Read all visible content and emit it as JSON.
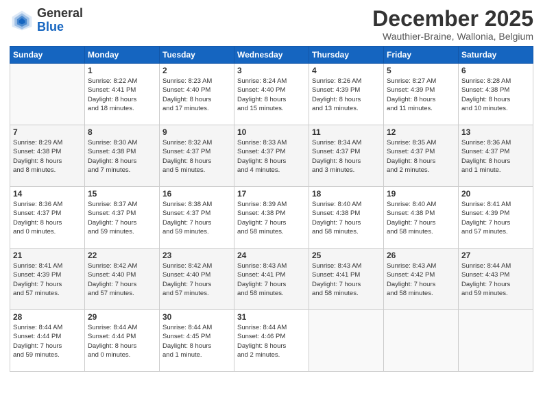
{
  "header": {
    "logo_general": "General",
    "logo_blue": "Blue",
    "month_title": "December 2025",
    "location": "Wauthier-Braine, Wallonia, Belgium"
  },
  "days_of_week": [
    "Sunday",
    "Monday",
    "Tuesday",
    "Wednesday",
    "Thursday",
    "Friday",
    "Saturday"
  ],
  "weeks": [
    [
      {
        "day": "",
        "info": ""
      },
      {
        "day": "1",
        "info": "Sunrise: 8:22 AM\nSunset: 4:41 PM\nDaylight: 8 hours\nand 18 minutes."
      },
      {
        "day": "2",
        "info": "Sunrise: 8:23 AM\nSunset: 4:40 PM\nDaylight: 8 hours\nand 17 minutes."
      },
      {
        "day": "3",
        "info": "Sunrise: 8:24 AM\nSunset: 4:40 PM\nDaylight: 8 hours\nand 15 minutes."
      },
      {
        "day": "4",
        "info": "Sunrise: 8:26 AM\nSunset: 4:39 PM\nDaylight: 8 hours\nand 13 minutes."
      },
      {
        "day": "5",
        "info": "Sunrise: 8:27 AM\nSunset: 4:39 PM\nDaylight: 8 hours\nand 11 minutes."
      },
      {
        "day": "6",
        "info": "Sunrise: 8:28 AM\nSunset: 4:38 PM\nDaylight: 8 hours\nand 10 minutes."
      }
    ],
    [
      {
        "day": "7",
        "info": "Sunrise: 8:29 AM\nSunset: 4:38 PM\nDaylight: 8 hours\nand 8 minutes."
      },
      {
        "day": "8",
        "info": "Sunrise: 8:30 AM\nSunset: 4:38 PM\nDaylight: 8 hours\nand 7 minutes."
      },
      {
        "day": "9",
        "info": "Sunrise: 8:32 AM\nSunset: 4:37 PM\nDaylight: 8 hours\nand 5 minutes."
      },
      {
        "day": "10",
        "info": "Sunrise: 8:33 AM\nSunset: 4:37 PM\nDaylight: 8 hours\nand 4 minutes."
      },
      {
        "day": "11",
        "info": "Sunrise: 8:34 AM\nSunset: 4:37 PM\nDaylight: 8 hours\nand 3 minutes."
      },
      {
        "day": "12",
        "info": "Sunrise: 8:35 AM\nSunset: 4:37 PM\nDaylight: 8 hours\nand 2 minutes."
      },
      {
        "day": "13",
        "info": "Sunrise: 8:36 AM\nSunset: 4:37 PM\nDaylight: 8 hours\nand 1 minute."
      }
    ],
    [
      {
        "day": "14",
        "info": "Sunrise: 8:36 AM\nSunset: 4:37 PM\nDaylight: 8 hours\nand 0 minutes."
      },
      {
        "day": "15",
        "info": "Sunrise: 8:37 AM\nSunset: 4:37 PM\nDaylight: 7 hours\nand 59 minutes."
      },
      {
        "day": "16",
        "info": "Sunrise: 8:38 AM\nSunset: 4:37 PM\nDaylight: 7 hours\nand 59 minutes."
      },
      {
        "day": "17",
        "info": "Sunrise: 8:39 AM\nSunset: 4:38 PM\nDaylight: 7 hours\nand 58 minutes."
      },
      {
        "day": "18",
        "info": "Sunrise: 8:40 AM\nSunset: 4:38 PM\nDaylight: 7 hours\nand 58 minutes."
      },
      {
        "day": "19",
        "info": "Sunrise: 8:40 AM\nSunset: 4:38 PM\nDaylight: 7 hours\nand 58 minutes."
      },
      {
        "day": "20",
        "info": "Sunrise: 8:41 AM\nSunset: 4:39 PM\nDaylight: 7 hours\nand 57 minutes."
      }
    ],
    [
      {
        "day": "21",
        "info": "Sunrise: 8:41 AM\nSunset: 4:39 PM\nDaylight: 7 hours\nand 57 minutes."
      },
      {
        "day": "22",
        "info": "Sunrise: 8:42 AM\nSunset: 4:40 PM\nDaylight: 7 hours\nand 57 minutes."
      },
      {
        "day": "23",
        "info": "Sunrise: 8:42 AM\nSunset: 4:40 PM\nDaylight: 7 hours\nand 57 minutes."
      },
      {
        "day": "24",
        "info": "Sunrise: 8:43 AM\nSunset: 4:41 PM\nDaylight: 7 hours\nand 58 minutes."
      },
      {
        "day": "25",
        "info": "Sunrise: 8:43 AM\nSunset: 4:41 PM\nDaylight: 7 hours\nand 58 minutes."
      },
      {
        "day": "26",
        "info": "Sunrise: 8:43 AM\nSunset: 4:42 PM\nDaylight: 7 hours\nand 58 minutes."
      },
      {
        "day": "27",
        "info": "Sunrise: 8:44 AM\nSunset: 4:43 PM\nDaylight: 7 hours\nand 59 minutes."
      }
    ],
    [
      {
        "day": "28",
        "info": "Sunrise: 8:44 AM\nSunset: 4:44 PM\nDaylight: 7 hours\nand 59 minutes."
      },
      {
        "day": "29",
        "info": "Sunrise: 8:44 AM\nSunset: 4:44 PM\nDaylight: 8 hours\nand 0 minutes."
      },
      {
        "day": "30",
        "info": "Sunrise: 8:44 AM\nSunset: 4:45 PM\nDaylight: 8 hours\nand 1 minute."
      },
      {
        "day": "31",
        "info": "Sunrise: 8:44 AM\nSunset: 4:46 PM\nDaylight: 8 hours\nand 2 minutes."
      },
      {
        "day": "",
        "info": ""
      },
      {
        "day": "",
        "info": ""
      },
      {
        "day": "",
        "info": ""
      }
    ]
  ]
}
